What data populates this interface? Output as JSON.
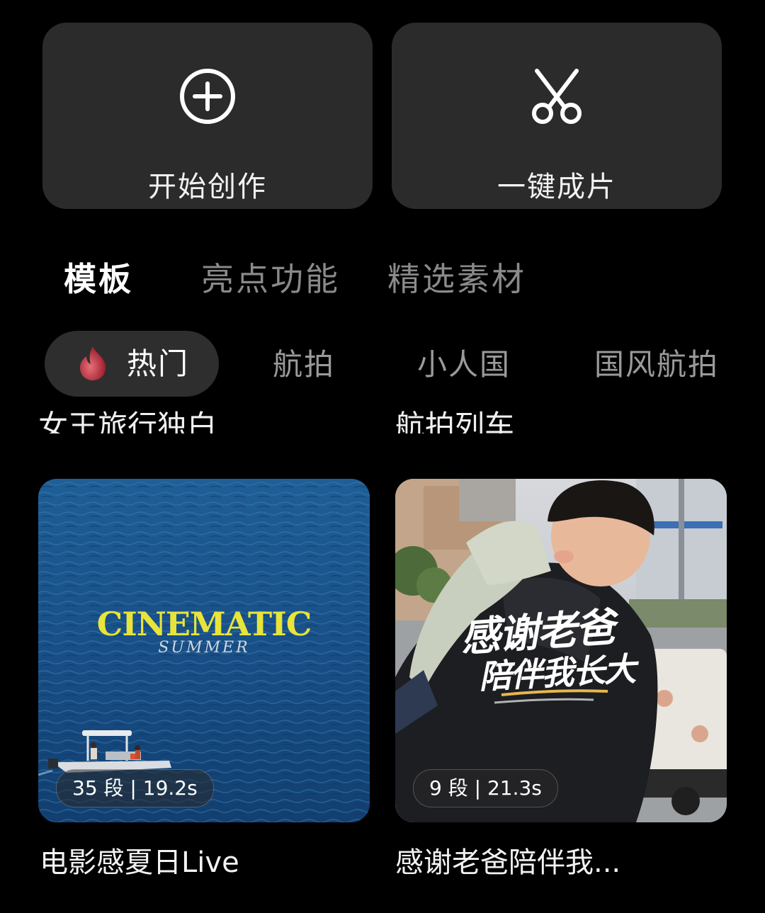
{
  "actions": {
    "start_label": "开始创作",
    "oneclick_label": "一键成片"
  },
  "main_tabs": [
    {
      "label": "模板",
      "active": true
    },
    {
      "label": "亮点功能",
      "active": false
    },
    {
      "label": "精选素材",
      "active": false
    }
  ],
  "sub_tabs": [
    {
      "label": "热门",
      "active": true,
      "icon": "fire-icon"
    },
    {
      "label": "航拍",
      "active": false
    },
    {
      "label": "小人国",
      "active": false
    },
    {
      "label": "国风航拍",
      "active": false
    }
  ],
  "previous_row_titles": [
    "女王旅行独白",
    "航拍列车"
  ],
  "templates": [
    {
      "title": "电影感夏日Live",
      "badge": "35 段 | 19.2s",
      "overlay_title": "CINEMATIC",
      "overlay_subtitle": "SUMMER"
    },
    {
      "title": "感谢老爸陪伴我...",
      "badge": "9 段 | 21.3s",
      "overlay_line1": "感谢老爸",
      "overlay_line2": "陪伴我长大"
    }
  ],
  "colors": {
    "background": "#000000",
    "card": "#2b2b2b",
    "chip": "#2e2e2e",
    "inactive_text": "#8a8a8a",
    "overlay_yellow": "#e8e43a"
  }
}
